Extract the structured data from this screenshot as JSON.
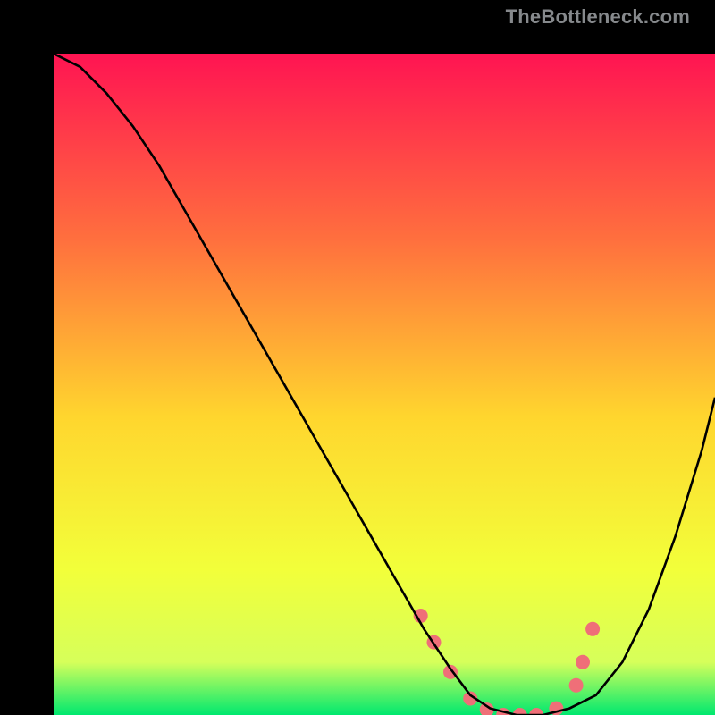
{
  "watermark": "TheBottleneck.com",
  "chart_data": {
    "type": "line",
    "title": "",
    "xlabel": "",
    "ylabel": "",
    "xlim": [
      0,
      100
    ],
    "ylim": [
      0,
      100
    ],
    "background_gradient": {
      "top": "#ff1452",
      "upper_mid": "#ff6f3e",
      "mid": "#ffd62e",
      "lower_mid": "#f2ff3a",
      "bottom": "#00e86f"
    },
    "series": [
      {
        "name": "bottleneck-curve",
        "stroke": "#000000",
        "x": [
          0,
          4,
          8,
          12,
          16,
          20,
          24,
          28,
          32,
          36,
          40,
          44,
          48,
          52,
          56,
          60,
          63,
          66,
          70,
          74,
          78,
          82,
          86,
          90,
          94,
          98,
          100
        ],
        "y": [
          100,
          98,
          94,
          89,
          83,
          76,
          69,
          62,
          55,
          48,
          41,
          34,
          27,
          20,
          13,
          7,
          3,
          1,
          0,
          0,
          1,
          3,
          8,
          16,
          27,
          40,
          48
        ]
      }
    ],
    "markers": {
      "name": "marker-dots",
      "fill": "#ef6f78",
      "radius": 8,
      "x": [
        55.5,
        57.5,
        60.0,
        63.0,
        65.5,
        68.0,
        70.5,
        73.0,
        76.0,
        79.0,
        80.0,
        81.5
      ],
      "y": [
        15.0,
        11.0,
        6.5,
        2.5,
        0.8,
        0.0,
        0.0,
        0.0,
        1.0,
        4.5,
        8.0,
        13.0
      ]
    }
  }
}
